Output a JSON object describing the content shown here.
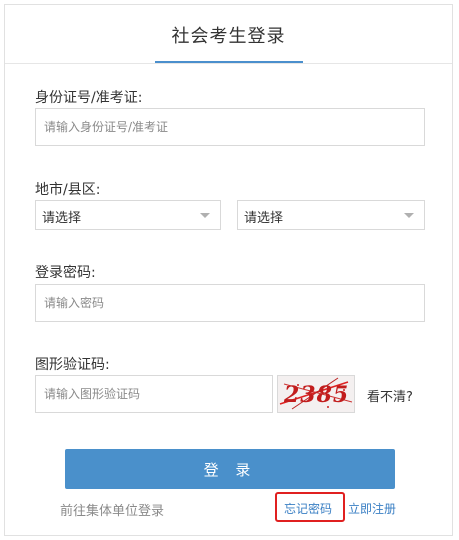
{
  "header": {
    "title": "社会考生登录",
    "accent_color": "#4a8fcd"
  },
  "form": {
    "id_label": "身份证号/准考证:",
    "id_placeholder": "请输入身份证号/准考证",
    "region_label": "地市/县区:",
    "city_select": "请选择",
    "county_select": "请选择",
    "password_label": "登录密码:",
    "password_placeholder": "请输入密码",
    "captcha_label": "图形验证码:",
    "captcha_placeholder": "请输入图形验证码",
    "captcha_text": "2385",
    "refresh_label": "看不清?"
  },
  "actions": {
    "login_label": "登 录",
    "group_login": "前往集体单位登录",
    "forgot_password": "忘记密码",
    "register": "立即注册",
    "primary_color": "#4a90cb",
    "highlight_color": "#e02020"
  }
}
